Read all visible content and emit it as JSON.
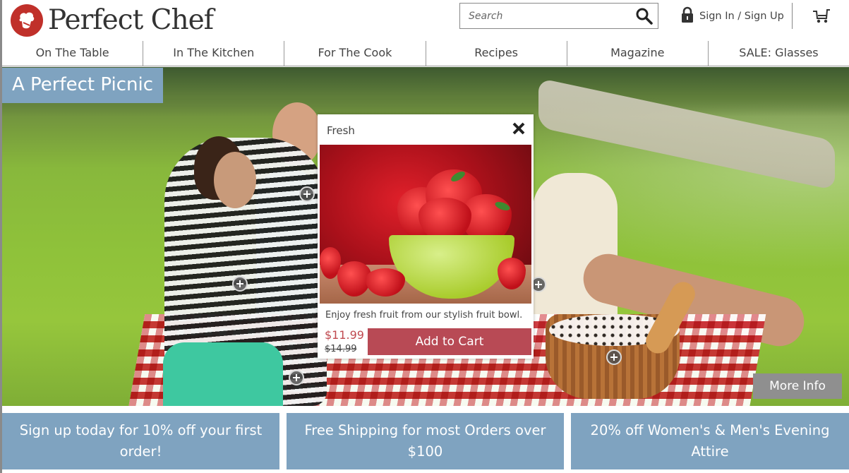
{
  "brand": {
    "name": "Perfect Chef",
    "logo_icon": "chef-hat-icon",
    "accent_color": "#c0302a"
  },
  "header": {
    "search": {
      "placeholder": "Search",
      "value": "",
      "icon": "search-icon"
    },
    "signin": {
      "label": "Sign In / Sign Up",
      "icon": "lock-icon"
    },
    "cart": {
      "icon": "cart-icon"
    }
  },
  "nav": {
    "items": [
      {
        "label": "On The Table"
      },
      {
        "label": "In The Kitchen"
      },
      {
        "label": "For The Cook"
      },
      {
        "label": "Recipes"
      },
      {
        "label": "Magazine"
      },
      {
        "label": "SALE: Glasses"
      }
    ]
  },
  "hero": {
    "title": "A Perfect Picnic",
    "more_info_label": "More Info",
    "hotspot_icon": "plus-circle-icon",
    "hotspot_count": 5
  },
  "popup": {
    "title": "Fresh",
    "close_icon": "close-icon",
    "image_alt": "Strawberries in a green fruit bowl",
    "description": "Enjoy fresh fruit from our stylish fruit bowl.",
    "price": "$11.99",
    "original_price": "$14.99",
    "add_to_cart_label": "Add to Cart"
  },
  "promos": [
    {
      "text": "Sign up today for 10% off your first order!"
    },
    {
      "text": "Free Shipping for most Orders over $100"
    },
    {
      "text": "20% off Women's & Men's Evening Attire"
    }
  ],
  "colors": {
    "promo_bg": "#7fa3c0",
    "add_to_cart_bg": "#b84a55",
    "sale_price": "#c04a50",
    "more_info_bg": "#8f8f8f"
  }
}
